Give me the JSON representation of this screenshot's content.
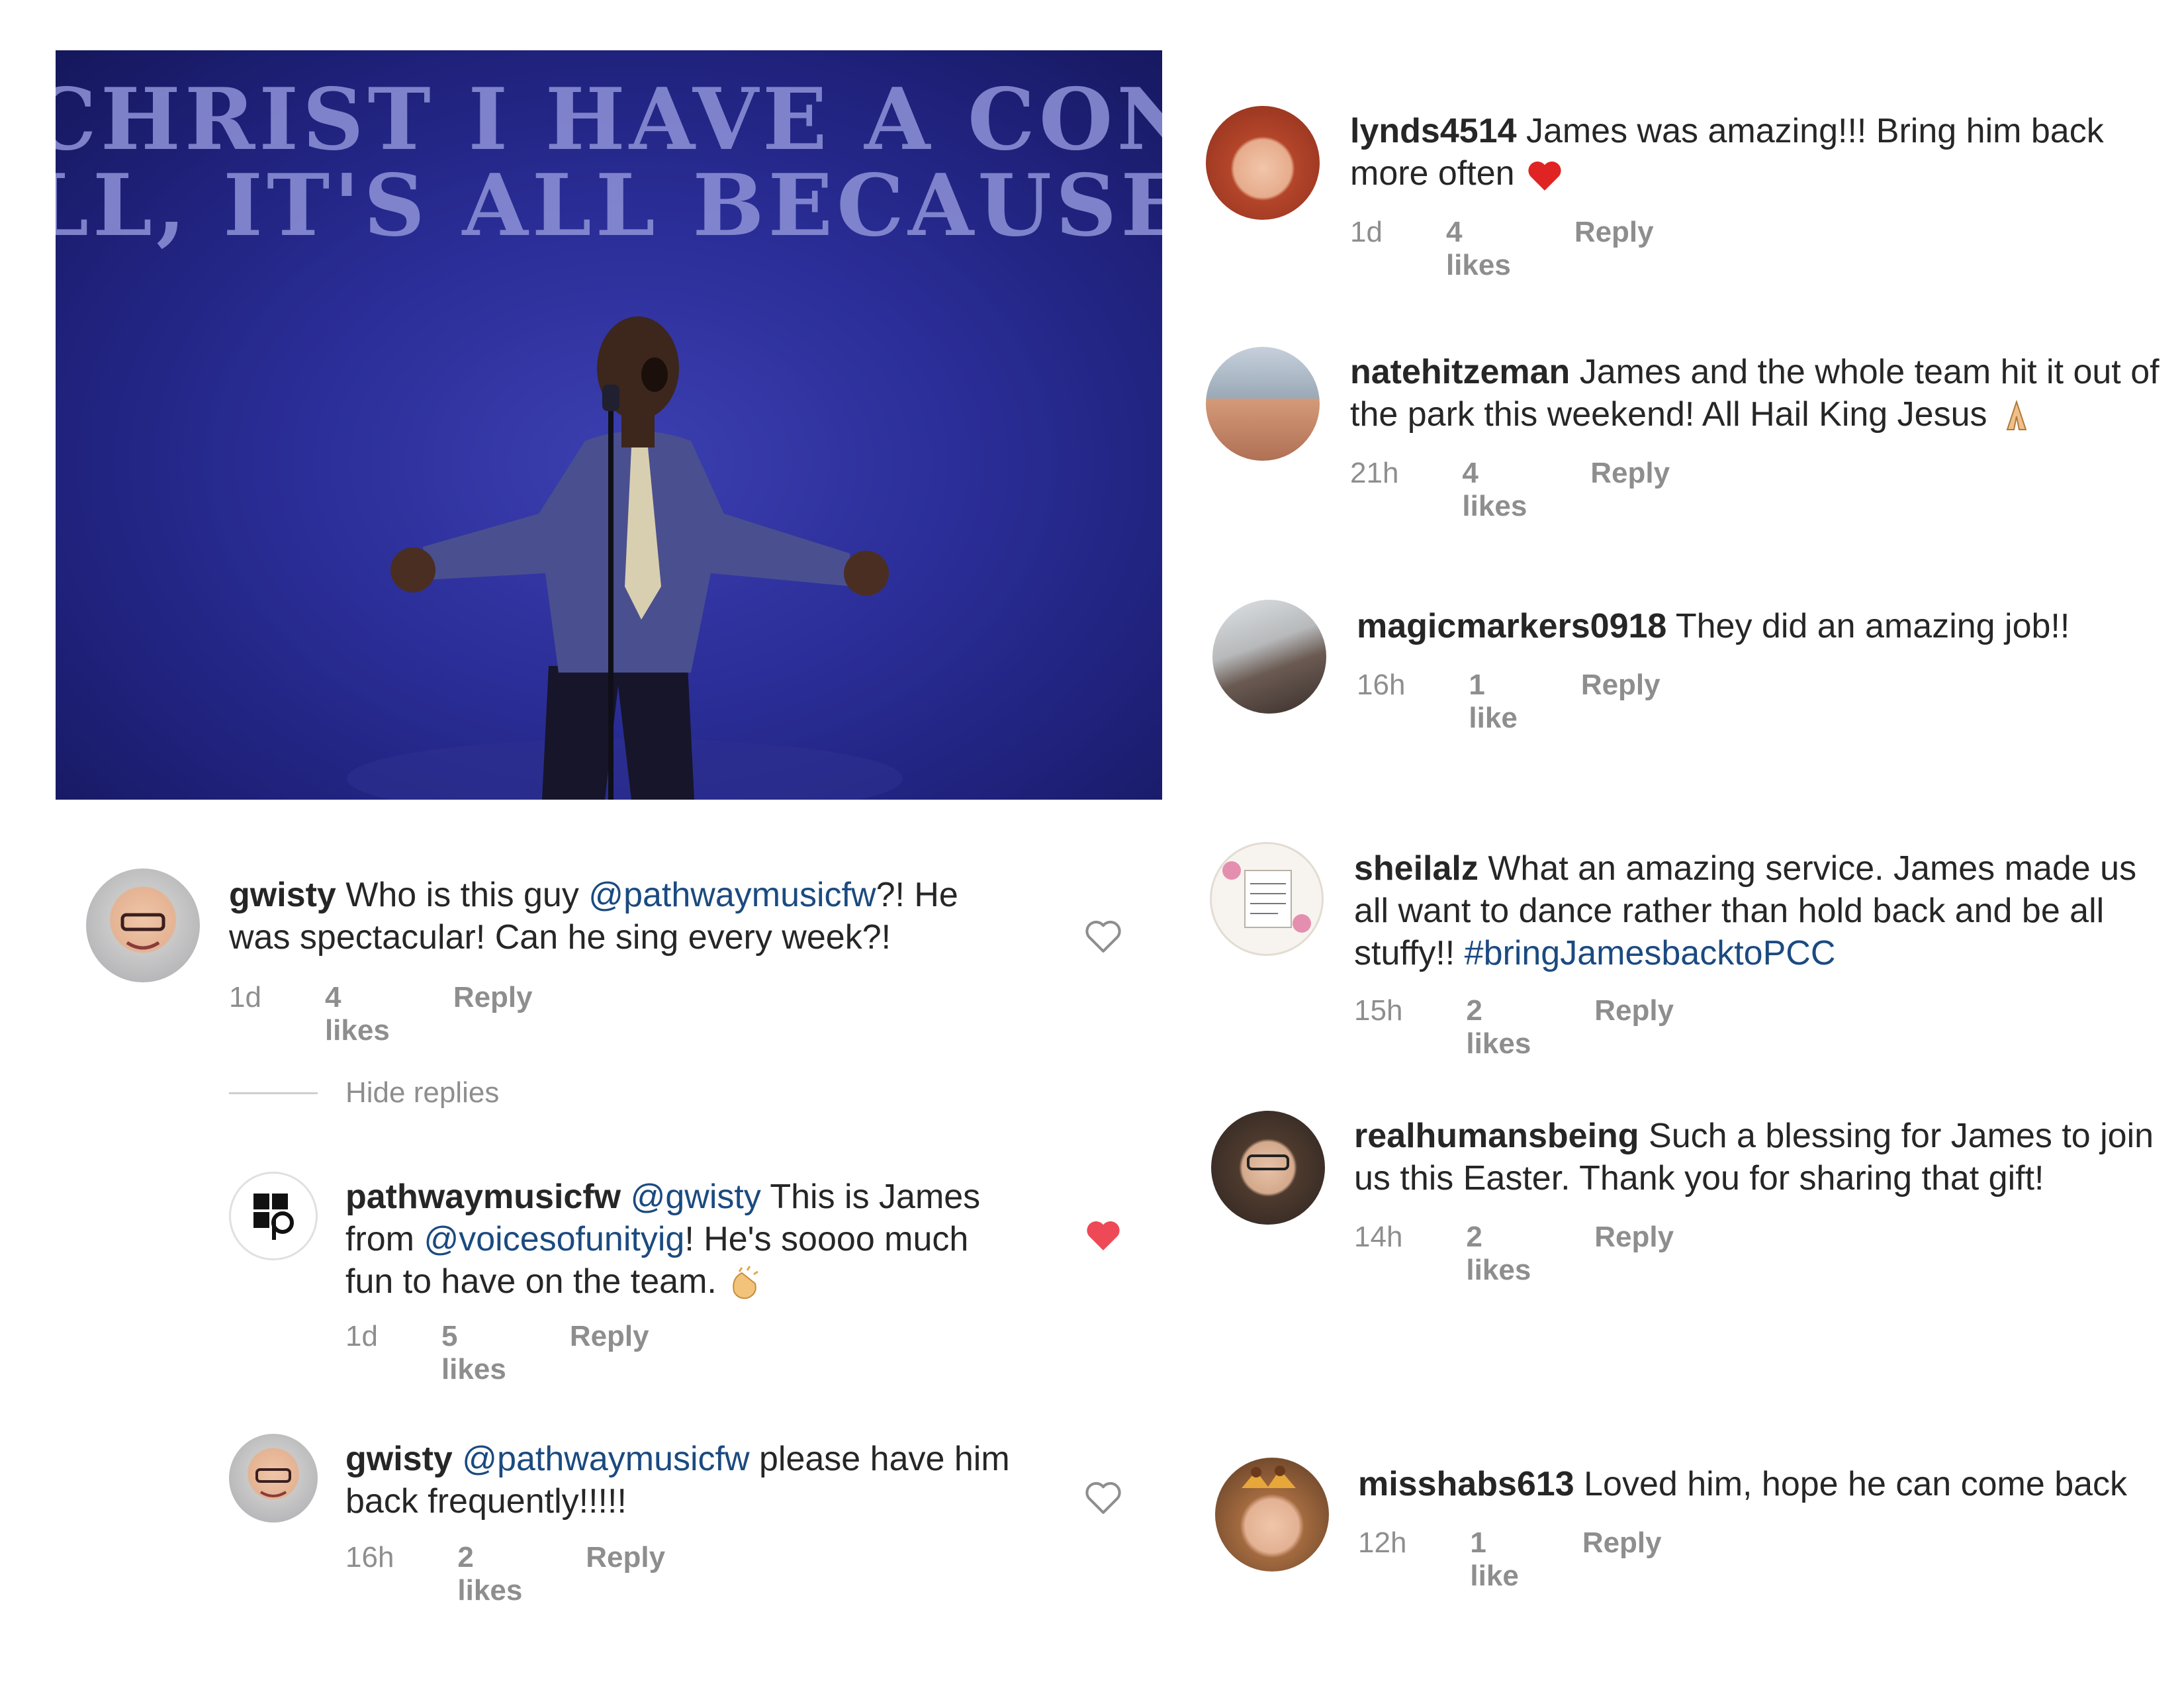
{
  "photo": {
    "banner_line1": "CHRIST I HAVE A CONFIDENC",
    "banner_line2": "LL, IT'S ALL BECAUSE OF CI"
  },
  "left": {
    "comment1": {
      "user": "gwisty",
      "pre": " Who is this guy ",
      "mention": "@pathwaymusicfw",
      "post": "?! He was spectacular! Can he sing every week?!",
      "time": "1d",
      "likes": "4 likes",
      "reply": "Reply"
    },
    "hide_replies": "Hide replies",
    "reply1": {
      "user": "pathwaymusicfw",
      "mention1": "@gwisty",
      "mid": " This is James from ",
      "mention2": "@voicesofunityig",
      "post": "! He's soooo much fun to have on the team. ",
      "time": "1d",
      "likes": "5 likes",
      "reply": "Reply"
    },
    "reply2": {
      "user": "gwisty",
      "mention": "@pathwaymusicfw",
      "post": " please have him back frequently!!!!!",
      "time": "16h",
      "likes": "2 likes",
      "reply": "Reply"
    }
  },
  "right": [
    {
      "user": "lynds4514",
      "text": " James was amazing!!! Bring him back more often ",
      "time": "1d",
      "likes": "4 likes",
      "reply": "Reply"
    },
    {
      "user": "natehitzeman",
      "text": " James and the whole team hit it out of the park this weekend!  All Hail King Jesus ",
      "time": "21h",
      "likes": "4 likes",
      "reply": "Reply"
    },
    {
      "user": "magicmarkers0918",
      "text": " They did an amazing job!!",
      "time": "16h",
      "likes": "1 like",
      "reply": "Reply"
    },
    {
      "user": "sheilalz",
      "text": " What an amazing service. James made us all want to dance rather than hold back and be all stuffy!! ",
      "tag": "#bringJamesbacktoPCC",
      "time": "15h",
      "likes": "2 likes",
      "reply": "Reply"
    },
    {
      "user": "realhumansbeing",
      "text": " Such a blessing for James to join us this Easter. Thank you for sharing that gift!",
      "time": "14h",
      "likes": "2 likes",
      "reply": "Reply"
    },
    {
      "user": "misshabs613",
      "text": " Loved him, hope he can come back",
      "time": "12h",
      "likes": "1 like",
      "reply": "Reply"
    }
  ],
  "colors": {
    "mention": "#1b4a80",
    "meta": "#8e8e8e",
    "liked_heart": "#ed4956",
    "banner": "#1e2078"
  },
  "icons": {
    "like": "heart-outline-icon",
    "liked": "heart-filled-icon",
    "emoji_heart": "red-heart-emoji",
    "emoji_pray": "praying-hands-emoji",
    "emoji_clap": "clapping-hands-emoji"
  }
}
